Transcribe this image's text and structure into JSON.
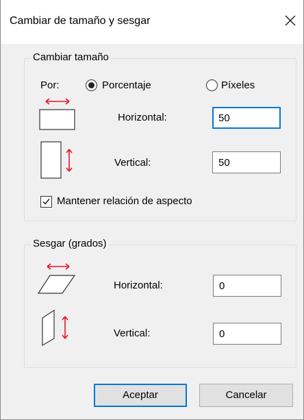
{
  "dialog": {
    "title": "Cambiar de tamaño y sesgar",
    "close_icon": "close-icon"
  },
  "resize": {
    "group_label": "Cambiar tamaño",
    "by_label": "Por:",
    "option_percentage": "Porcentaje",
    "option_pixels": "Píxeles",
    "selected": "Porcentaje",
    "horizontal_label": "Horizontal:",
    "horizontal_value": "50",
    "vertical_label": "Vertical:",
    "vertical_value": "50",
    "keep_aspect_label": "Mantener relación de aspecto",
    "keep_aspect_checked": true
  },
  "skew": {
    "group_label": "Sesgar (grados)",
    "horizontal_label": "Horizontal:",
    "horizontal_value": "0",
    "vertical_label": "Vertical:",
    "vertical_value": "0"
  },
  "buttons": {
    "ok_label": "Aceptar",
    "cancel_label": "Cancelar"
  },
  "colors": {
    "accent": "#0078d7",
    "arrow": "#e81123"
  }
}
